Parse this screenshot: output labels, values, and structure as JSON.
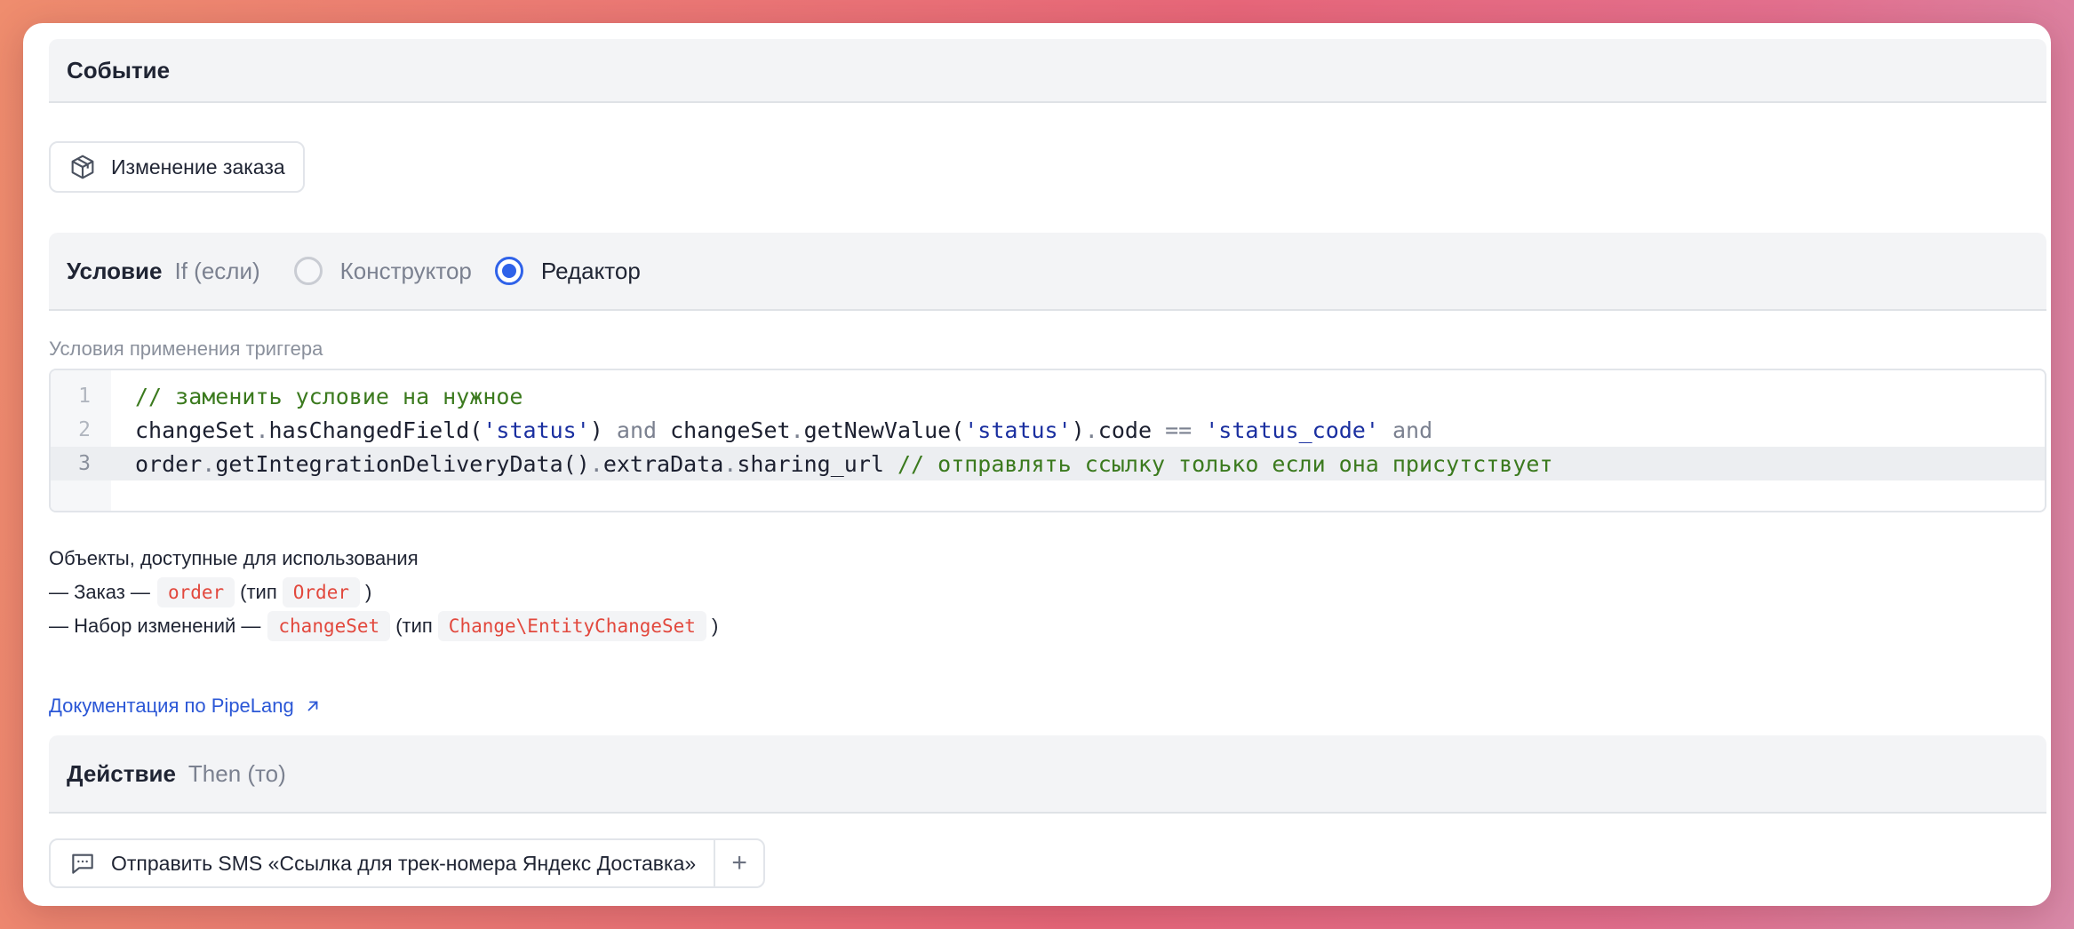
{
  "event": {
    "title": "Событие",
    "chip_label": "Изменение заказа",
    "chip_icon": "box-icon"
  },
  "condition": {
    "title": "Условие",
    "subtitle": "If (если)",
    "modes": [
      {
        "label": "Конструктор",
        "selected": false
      },
      {
        "label": "Редактор",
        "selected": true
      }
    ],
    "field_label": "Условия применения триггера",
    "code_lines": [
      {
        "number": "1",
        "text": "// заменить условие на нужное"
      },
      {
        "number": "2",
        "text": "changeSet.hasChangedField('status') and changeSet.getNewValue('status').code == 'status_code' and"
      },
      {
        "number": "3",
        "text": "order.getIntegrationDeliveryData().extraData.sharing_url // отправлять ссылку только если она присутствует"
      }
    ],
    "active_line": 3
  },
  "objects": {
    "heading": "Объекты, доступные для использования",
    "items": [
      {
        "prefix": "— Заказ —",
        "name": "order",
        "type_prefix": "(тип",
        "type": "Order",
        "suffix": ")"
      },
      {
        "prefix": "— Набор изменений —",
        "name": "changeSet",
        "type_prefix": "(тип",
        "type": "Change\\EntityChangeSet",
        "suffix": ")"
      }
    ]
  },
  "docs": {
    "link_label": "Документация по PipeLang",
    "link_icon": "arrow-up-right-icon"
  },
  "action": {
    "title": "Действие",
    "subtitle": "Then (то)",
    "button_label": "Отправить SMS «Ссылка для трек-номера Яндекс Доставка»",
    "button_icon": "message-icon",
    "add_label": "+"
  },
  "colors": {
    "accent": "#2f62e9",
    "link": "#2b57d6",
    "tag_text": "#e2483d",
    "comment": "#3b7a1e",
    "string": "#1a2fa0"
  }
}
